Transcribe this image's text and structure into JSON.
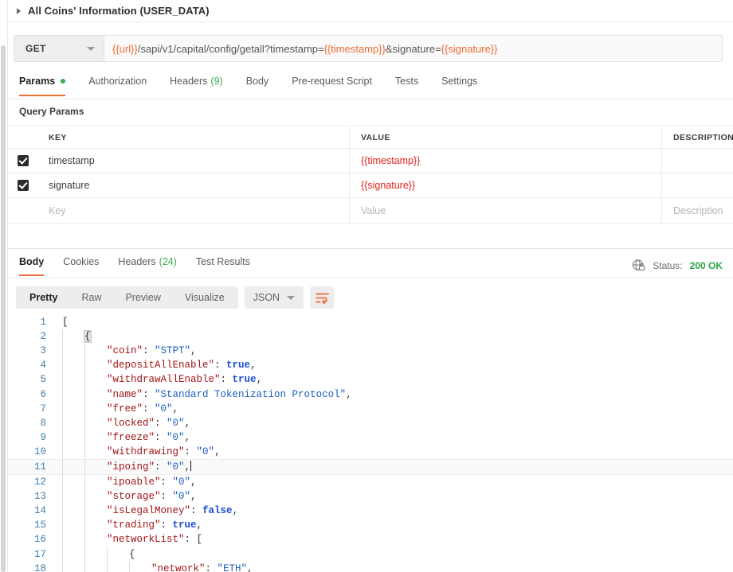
{
  "request": {
    "title": "All Coins' Information (USER_DATA)",
    "collapse_icon": "caret-right-icon",
    "method": "GET",
    "method_caret": "chevron-down-icon",
    "url_parts": [
      {
        "t": "{{url}}",
        "v": true
      },
      {
        "t": "/sapi/v1/capital/config/getall?timestamp=",
        "v": false
      },
      {
        "t": "{{timestamp}}",
        "v": true
      },
      {
        "t": "&signature=",
        "v": false
      },
      {
        "t": "{{signature}}",
        "v": true
      }
    ],
    "tabs": [
      {
        "label": "Params",
        "active": true,
        "dot": true
      },
      {
        "label": "Authorization",
        "active": false
      },
      {
        "label": "Headers",
        "active": false,
        "count": "(9)"
      },
      {
        "label": "Body",
        "active": false
      },
      {
        "label": "Pre-request Script",
        "active": false
      },
      {
        "label": "Tests",
        "active": false
      },
      {
        "label": "Settings",
        "active": false
      }
    ],
    "section_title": "Query Params",
    "table": {
      "headers": [
        "KEY",
        "VALUE",
        "DESCRIPTION"
      ],
      "rows": [
        {
          "checked": true,
          "key": "timestamp",
          "value": "{{timestamp}}",
          "desc": "",
          "value_red": true,
          "placeholder": false
        },
        {
          "checked": true,
          "key": "signature",
          "value": "{{signature}}",
          "desc": "",
          "value_red": true,
          "placeholder": false
        },
        {
          "checked": false,
          "key": "Key",
          "value": "Value",
          "desc": "Description",
          "value_red": false,
          "placeholder": true
        }
      ]
    }
  },
  "response": {
    "tabs": [
      {
        "label": "Body",
        "active": true
      },
      {
        "label": "Cookies",
        "active": false
      },
      {
        "label": "Headers",
        "active": false,
        "count": "(24)"
      },
      {
        "label": "Test Results",
        "active": false
      }
    ],
    "status_icon": "globe-lock-icon",
    "status_label": "Status:",
    "status_code": "200 OK",
    "view_modes": [
      {
        "label": "Pretty",
        "active": true
      },
      {
        "label": "Raw",
        "active": false
      },
      {
        "label": "Preview",
        "active": false
      },
      {
        "label": "Visualize",
        "active": false
      }
    ],
    "format": "JSON",
    "format_caret": "chevron-down-icon",
    "wrap_icon": "wrap-text-icon"
  },
  "code": {
    "active_line": 11,
    "lines": [
      {
        "n": "1",
        "indent": 0,
        "tokens": [
          {
            "t": "[",
            "c": "pun"
          }
        ]
      },
      {
        "n": "2",
        "indent": 1,
        "tokens": [
          {
            "t": "{",
            "c": "pun",
            "hl": true
          }
        ]
      },
      {
        "n": "3",
        "indent": 2,
        "tokens": [
          {
            "t": "\"coin\"",
            "c": "key"
          },
          {
            "t": ": ",
            "c": "pun"
          },
          {
            "t": "\"STPT\"",
            "c": "str"
          },
          {
            "t": ",",
            "c": "pun"
          }
        ]
      },
      {
        "n": "4",
        "indent": 2,
        "tokens": [
          {
            "t": "\"depositAllEnable\"",
            "c": "key"
          },
          {
            "t": ": ",
            "c": "pun"
          },
          {
            "t": "true",
            "c": "bool"
          },
          {
            "t": ",",
            "c": "pun"
          }
        ]
      },
      {
        "n": "5",
        "indent": 2,
        "tokens": [
          {
            "t": "\"withdrawAllEnable\"",
            "c": "key"
          },
          {
            "t": ": ",
            "c": "pun"
          },
          {
            "t": "true",
            "c": "bool"
          },
          {
            "t": ",",
            "c": "pun"
          }
        ]
      },
      {
        "n": "6",
        "indent": 2,
        "tokens": [
          {
            "t": "\"name\"",
            "c": "key"
          },
          {
            "t": ": ",
            "c": "pun"
          },
          {
            "t": "\"Standard Tokenization Protocol\"",
            "c": "str"
          },
          {
            "t": ",",
            "c": "pun"
          }
        ]
      },
      {
        "n": "7",
        "indent": 2,
        "tokens": [
          {
            "t": "\"free\"",
            "c": "key"
          },
          {
            "t": ": ",
            "c": "pun"
          },
          {
            "t": "\"0\"",
            "c": "str"
          },
          {
            "t": ",",
            "c": "pun"
          }
        ]
      },
      {
        "n": "8",
        "indent": 2,
        "tokens": [
          {
            "t": "\"locked\"",
            "c": "key"
          },
          {
            "t": ": ",
            "c": "pun"
          },
          {
            "t": "\"0\"",
            "c": "str"
          },
          {
            "t": ",",
            "c": "pun"
          }
        ]
      },
      {
        "n": "9",
        "indent": 2,
        "tokens": [
          {
            "t": "\"freeze\"",
            "c": "key"
          },
          {
            "t": ": ",
            "c": "pun"
          },
          {
            "t": "\"0\"",
            "c": "str"
          },
          {
            "t": ",",
            "c": "pun"
          }
        ]
      },
      {
        "n": "10",
        "indent": 2,
        "tokens": [
          {
            "t": "\"withdrawing\"",
            "c": "key"
          },
          {
            "t": ": ",
            "c": "pun"
          },
          {
            "t": "\"0\"",
            "c": "str"
          },
          {
            "t": ",",
            "c": "pun"
          }
        ]
      },
      {
        "n": "11",
        "indent": 2,
        "tokens": [
          {
            "t": "\"ipoing\"",
            "c": "key"
          },
          {
            "t": ": ",
            "c": "pun"
          },
          {
            "t": "\"0\"",
            "c": "str"
          },
          {
            "t": ",",
            "c": "pun"
          }
        ],
        "caret": true
      },
      {
        "n": "12",
        "indent": 2,
        "tokens": [
          {
            "t": "\"ipoable\"",
            "c": "key"
          },
          {
            "t": ": ",
            "c": "pun"
          },
          {
            "t": "\"0\"",
            "c": "str"
          },
          {
            "t": ",",
            "c": "pun"
          }
        ]
      },
      {
        "n": "13",
        "indent": 2,
        "tokens": [
          {
            "t": "\"storage\"",
            "c": "key"
          },
          {
            "t": ": ",
            "c": "pun"
          },
          {
            "t": "\"0\"",
            "c": "str"
          },
          {
            "t": ",",
            "c": "pun"
          }
        ]
      },
      {
        "n": "14",
        "indent": 2,
        "tokens": [
          {
            "t": "\"isLegalMoney\"",
            "c": "key"
          },
          {
            "t": ": ",
            "c": "pun"
          },
          {
            "t": "false",
            "c": "bool"
          },
          {
            "t": ",",
            "c": "pun"
          }
        ]
      },
      {
        "n": "15",
        "indent": 2,
        "tokens": [
          {
            "t": "\"trading\"",
            "c": "key"
          },
          {
            "t": ": ",
            "c": "pun"
          },
          {
            "t": "true",
            "c": "bool"
          },
          {
            "t": ",",
            "c": "pun"
          }
        ]
      },
      {
        "n": "16",
        "indent": 2,
        "tokens": [
          {
            "t": "\"networkList\"",
            "c": "key"
          },
          {
            "t": ": ",
            "c": "pun"
          },
          {
            "t": "[",
            "c": "pun"
          }
        ]
      },
      {
        "n": "17",
        "indent": 3,
        "tokens": [
          {
            "t": "{",
            "c": "pun"
          }
        ]
      },
      {
        "n": "18",
        "indent": 4,
        "tokens": [
          {
            "t": "\"network\"",
            "c": "key"
          },
          {
            "t": ": ",
            "c": "pun"
          },
          {
            "t": "\"ETH\"",
            "c": "str"
          },
          {
            "t": ",",
            "c": "pun"
          }
        ]
      }
    ]
  }
}
